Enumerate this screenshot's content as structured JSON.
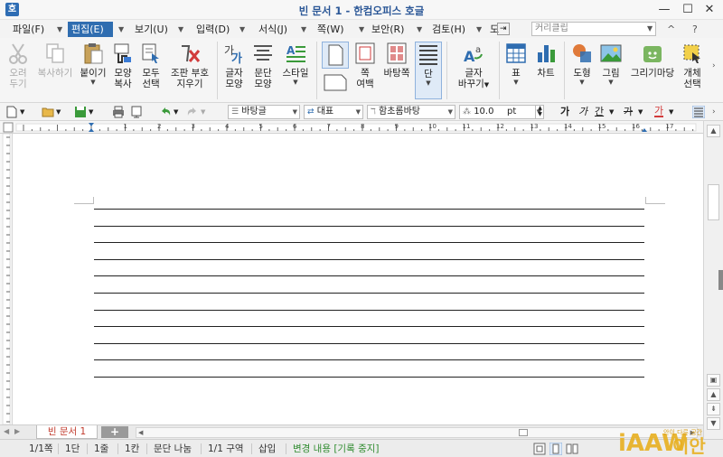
{
  "window": {
    "title": "빈 문서 1 - 한컴오피스 호글",
    "min": "—",
    "max": "☐",
    "close": "✕"
  },
  "menu": {
    "items": [
      {
        "label": "파일(F)"
      },
      {
        "label": "편집(E)"
      },
      {
        "label": "보기(U)"
      },
      {
        "label": "입력(D)"
      },
      {
        "label": "서식(J)"
      },
      {
        "label": "쪽(W)"
      },
      {
        "label": "보안(R)"
      },
      {
        "label": "검토(H)"
      },
      {
        "label": "도"
      }
    ],
    "search_placeholder": "커리클립",
    "help": "?",
    "collapse": "^"
  },
  "ribbon": {
    "cut": {
      "l1": "오려",
      "l2": "두기"
    },
    "copy": {
      "l1": "복사하기"
    },
    "paste": {
      "l1": "붙이기"
    },
    "format_copy": {
      "l1": "모양",
      "l2": "복사"
    },
    "select_all": {
      "l1": "모두",
      "l2": "선택"
    },
    "erase_marks": {
      "l1": "조판 부호",
      "l2": "지우기"
    },
    "char_shape": {
      "l1": "글자",
      "l2": "모양"
    },
    "para_shape": {
      "l1": "문단",
      "l2": "모양"
    },
    "style": {
      "l1": "스타일"
    },
    "page_margin": {
      "l1": "쪽",
      "l2": "여백"
    },
    "background": {
      "l1": "바탕쪽"
    },
    "columns": {
      "l1": "단"
    },
    "char_replace": {
      "l1": "글자",
      "l2": "바꾸기"
    },
    "table": {
      "l1": "표"
    },
    "chart": {
      "l1": "차트"
    },
    "shape": {
      "l1": "도형"
    },
    "picture": {
      "l1": "그림"
    },
    "clipart": {
      "l1": "그리기마당"
    },
    "object_select": {
      "l1": "개체",
      "l2": "선택"
    }
  },
  "toolbar": {
    "style_value": "바탕글",
    "lang_value": "대표",
    "font_value": "함초롬바탕",
    "size_value": "10.0",
    "size_unit": "pt",
    "bold": "가",
    "italic": "가",
    "underline": "간",
    "strike": "가",
    "color": "가"
  },
  "tabs": {
    "doc_tab": "빈 문서 1",
    "add": "+"
  },
  "status": {
    "page": "1/1쪽",
    "column": "1단",
    "line": "1줄",
    "col": "1칸",
    "para_break": "문단 나눔",
    "section": "1/1 구역",
    "insert": "삽입",
    "track": "변경 내용 [기록 중지]"
  },
  "watermark": {
    "text": "iAAW 이안",
    "tag": "안이 다른 공간"
  },
  "colors": {
    "accent": "#2f6db0",
    "track_text": "#2e8b2e",
    "tab_text": "#c0392b"
  }
}
